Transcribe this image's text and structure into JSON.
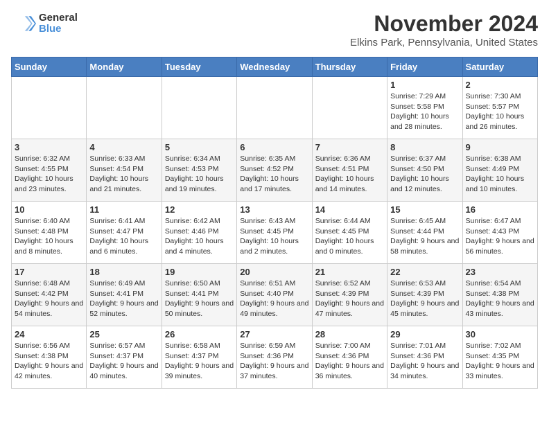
{
  "logo": {
    "general": "General",
    "blue": "Blue"
  },
  "title": "November 2024",
  "subtitle": "Elkins Park, Pennsylvania, United States",
  "days_of_week": [
    "Sunday",
    "Monday",
    "Tuesday",
    "Wednesday",
    "Thursday",
    "Friday",
    "Saturday"
  ],
  "weeks": [
    [
      {
        "day": "",
        "info": ""
      },
      {
        "day": "",
        "info": ""
      },
      {
        "day": "",
        "info": ""
      },
      {
        "day": "",
        "info": ""
      },
      {
        "day": "",
        "info": ""
      },
      {
        "day": "1",
        "info": "Sunrise: 7:29 AM\nSunset: 5:58 PM\nDaylight: 10 hours and 28 minutes."
      },
      {
        "day": "2",
        "info": "Sunrise: 7:30 AM\nSunset: 5:57 PM\nDaylight: 10 hours and 26 minutes."
      }
    ],
    [
      {
        "day": "3",
        "info": "Sunrise: 6:32 AM\nSunset: 4:55 PM\nDaylight: 10 hours and 23 minutes."
      },
      {
        "day": "4",
        "info": "Sunrise: 6:33 AM\nSunset: 4:54 PM\nDaylight: 10 hours and 21 minutes."
      },
      {
        "day": "5",
        "info": "Sunrise: 6:34 AM\nSunset: 4:53 PM\nDaylight: 10 hours and 19 minutes."
      },
      {
        "day": "6",
        "info": "Sunrise: 6:35 AM\nSunset: 4:52 PM\nDaylight: 10 hours and 17 minutes."
      },
      {
        "day": "7",
        "info": "Sunrise: 6:36 AM\nSunset: 4:51 PM\nDaylight: 10 hours and 14 minutes."
      },
      {
        "day": "8",
        "info": "Sunrise: 6:37 AM\nSunset: 4:50 PM\nDaylight: 10 hours and 12 minutes."
      },
      {
        "day": "9",
        "info": "Sunrise: 6:38 AM\nSunset: 4:49 PM\nDaylight: 10 hours and 10 minutes."
      }
    ],
    [
      {
        "day": "10",
        "info": "Sunrise: 6:40 AM\nSunset: 4:48 PM\nDaylight: 10 hours and 8 minutes."
      },
      {
        "day": "11",
        "info": "Sunrise: 6:41 AM\nSunset: 4:47 PM\nDaylight: 10 hours and 6 minutes."
      },
      {
        "day": "12",
        "info": "Sunrise: 6:42 AM\nSunset: 4:46 PM\nDaylight: 10 hours and 4 minutes."
      },
      {
        "day": "13",
        "info": "Sunrise: 6:43 AM\nSunset: 4:45 PM\nDaylight: 10 hours and 2 minutes."
      },
      {
        "day": "14",
        "info": "Sunrise: 6:44 AM\nSunset: 4:45 PM\nDaylight: 10 hours and 0 minutes."
      },
      {
        "day": "15",
        "info": "Sunrise: 6:45 AM\nSunset: 4:44 PM\nDaylight: 9 hours and 58 minutes."
      },
      {
        "day": "16",
        "info": "Sunrise: 6:47 AM\nSunset: 4:43 PM\nDaylight: 9 hours and 56 minutes."
      }
    ],
    [
      {
        "day": "17",
        "info": "Sunrise: 6:48 AM\nSunset: 4:42 PM\nDaylight: 9 hours and 54 minutes."
      },
      {
        "day": "18",
        "info": "Sunrise: 6:49 AM\nSunset: 4:41 PM\nDaylight: 9 hours and 52 minutes."
      },
      {
        "day": "19",
        "info": "Sunrise: 6:50 AM\nSunset: 4:41 PM\nDaylight: 9 hours and 50 minutes."
      },
      {
        "day": "20",
        "info": "Sunrise: 6:51 AM\nSunset: 4:40 PM\nDaylight: 9 hours and 49 minutes."
      },
      {
        "day": "21",
        "info": "Sunrise: 6:52 AM\nSunset: 4:39 PM\nDaylight: 9 hours and 47 minutes."
      },
      {
        "day": "22",
        "info": "Sunrise: 6:53 AM\nSunset: 4:39 PM\nDaylight: 9 hours and 45 minutes."
      },
      {
        "day": "23",
        "info": "Sunrise: 6:54 AM\nSunset: 4:38 PM\nDaylight: 9 hours and 43 minutes."
      }
    ],
    [
      {
        "day": "24",
        "info": "Sunrise: 6:56 AM\nSunset: 4:38 PM\nDaylight: 9 hours and 42 minutes."
      },
      {
        "day": "25",
        "info": "Sunrise: 6:57 AM\nSunset: 4:37 PM\nDaylight: 9 hours and 40 minutes."
      },
      {
        "day": "26",
        "info": "Sunrise: 6:58 AM\nSunset: 4:37 PM\nDaylight: 9 hours and 39 minutes."
      },
      {
        "day": "27",
        "info": "Sunrise: 6:59 AM\nSunset: 4:36 PM\nDaylight: 9 hours and 37 minutes."
      },
      {
        "day": "28",
        "info": "Sunrise: 7:00 AM\nSunset: 4:36 PM\nDaylight: 9 hours and 36 minutes."
      },
      {
        "day": "29",
        "info": "Sunrise: 7:01 AM\nSunset: 4:36 PM\nDaylight: 9 hours and 34 minutes."
      },
      {
        "day": "30",
        "info": "Sunrise: 7:02 AM\nSunset: 4:35 PM\nDaylight: 9 hours and 33 minutes."
      }
    ]
  ],
  "colors": {
    "header_bg": "#4a7fc1",
    "header_text": "#ffffff",
    "cell_bg_odd": "#ffffff",
    "cell_bg_even": "#f5f5f5"
  }
}
